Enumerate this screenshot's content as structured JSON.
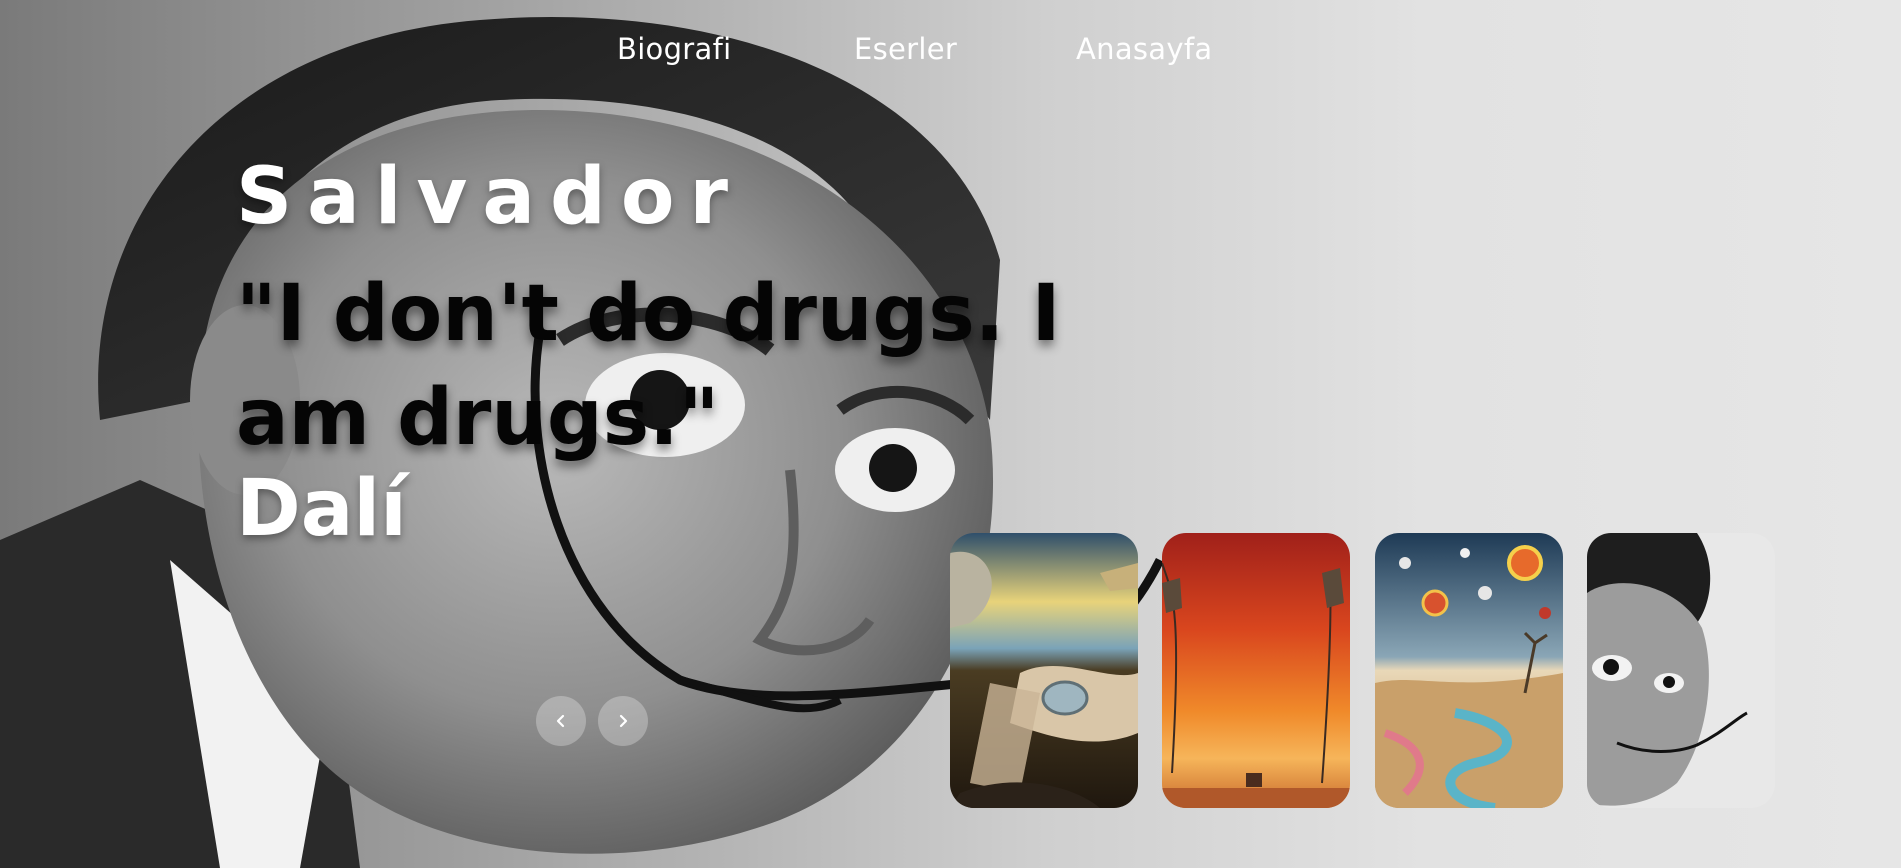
{
  "nav": {
    "items": [
      {
        "label": "Biografi"
      },
      {
        "label": "Eserler"
      },
      {
        "label": "Anasayfa"
      }
    ]
  },
  "hero": {
    "first_name": "Salvador",
    "quote": "\"I don't do drugs. I am drugs.\"",
    "last_name": "Dalí"
  },
  "slider": {
    "prev_icon": "chevron-left-icon",
    "next_icon": "chevron-right-icon"
  },
  "cards": [
    {
      "name": "persistence-of-memory-painting"
    },
    {
      "name": "orange-desert-elephants-painting"
    },
    {
      "name": "surreal-swirl-landscape-painting"
    },
    {
      "name": "dali-portrait"
    }
  ],
  "colors": {
    "nav_text": "#ffffff",
    "hero_white": "#ffffff",
    "hero_quote": "#050505"
  }
}
